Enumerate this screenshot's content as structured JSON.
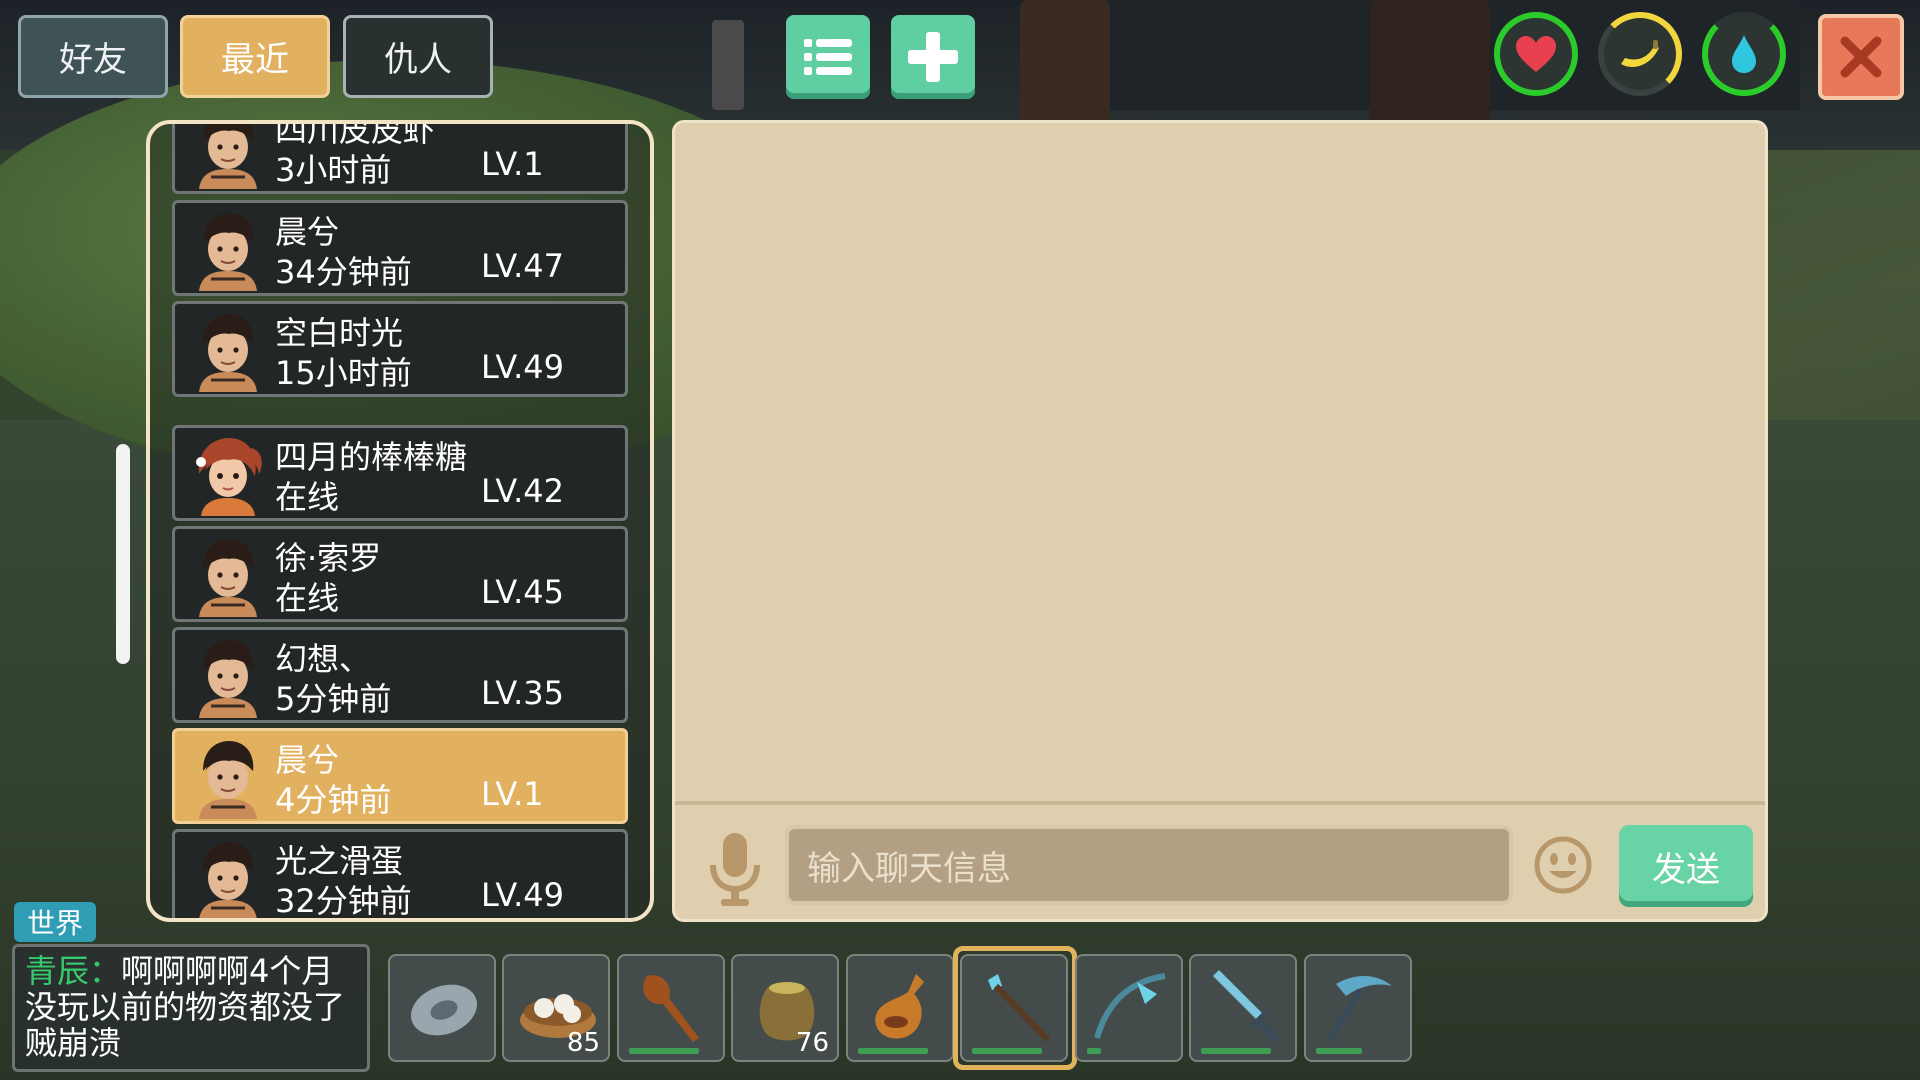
{
  "tabs": [
    {
      "label": "好友",
      "active": false
    },
    {
      "label": "最近",
      "active": true
    },
    {
      "label": "仇人",
      "active": false
    }
  ],
  "toolbar": {
    "list_icon": "list-icon",
    "add_icon": "plus-icon",
    "close_icon": "close-icon"
  },
  "stats": [
    {
      "name": "health",
      "icon": "heart-icon",
      "color": "#e8404f",
      "level": 1.0
    },
    {
      "name": "hunger",
      "icon": "banana-icon",
      "color": "#f2d73c",
      "level": 0.4
    },
    {
      "name": "thirst",
      "icon": "water-drop-icon",
      "color": "#2fc7e0",
      "level": 0.9
    }
  ],
  "friends": [
    {
      "name": "四川皮皮虾",
      "time": "3小时前",
      "level": "LV.1",
      "avatar": "boy"
    },
    {
      "name": "晨兮",
      "time": "34分钟前",
      "level": "LV.47",
      "avatar": "boy"
    },
    {
      "name": "空白时光",
      "time": "15小时前",
      "level": "LV.49",
      "avatar": "boy"
    },
    {
      "name": "四月的棒棒糖",
      "time": "在线",
      "level": "LV.42",
      "avatar": "girl"
    },
    {
      "name": "徐·索罗",
      "time": "在线",
      "level": "LV.45",
      "avatar": "boy"
    },
    {
      "name": "幻想、",
      "time": "5分钟前",
      "level": "LV.35",
      "avatar": "boy"
    },
    {
      "name": "晨兮",
      "time": "4分钟前",
      "level": "LV.1",
      "avatar": "boy",
      "selected": true
    },
    {
      "name": "光之滑蛋",
      "time": "32分钟前",
      "level": "LV.49",
      "avatar": "boy"
    }
  ],
  "chat": {
    "input_placeholder": "输入聊天信息",
    "send_label": "发送"
  },
  "world_chat": {
    "tag": "世界",
    "sender": "青辰：",
    "message": "啊啊啊啊4个月没玩以前的物资都没了贼崩溃"
  },
  "hotbar": [
    {
      "item": "stone-disc",
      "count": ""
    },
    {
      "item": "steamed-buns",
      "count": "85"
    },
    {
      "item": "club",
      "count": "",
      "durability": 0.8
    },
    {
      "item": "seed-sack",
      "count": "76"
    },
    {
      "item": "water-gourd",
      "count": "",
      "durability": 0.9
    },
    {
      "item": "crystal-staff",
      "count": "",
      "durability": 0.7,
      "selected": true
    },
    {
      "item": "crystal-bow",
      "count": "",
      "durability": 0.1
    },
    {
      "item": "crystal-sword",
      "count": "",
      "durability": 0.7
    },
    {
      "item": "pickaxe",
      "count": "",
      "durability": 0.5
    }
  ],
  "colors": {
    "tab_active": "#e1b15f",
    "accent_green": "#5fcea0",
    "chat_bg": "#dfcfae",
    "world_tag": "#2f9db3"
  }
}
